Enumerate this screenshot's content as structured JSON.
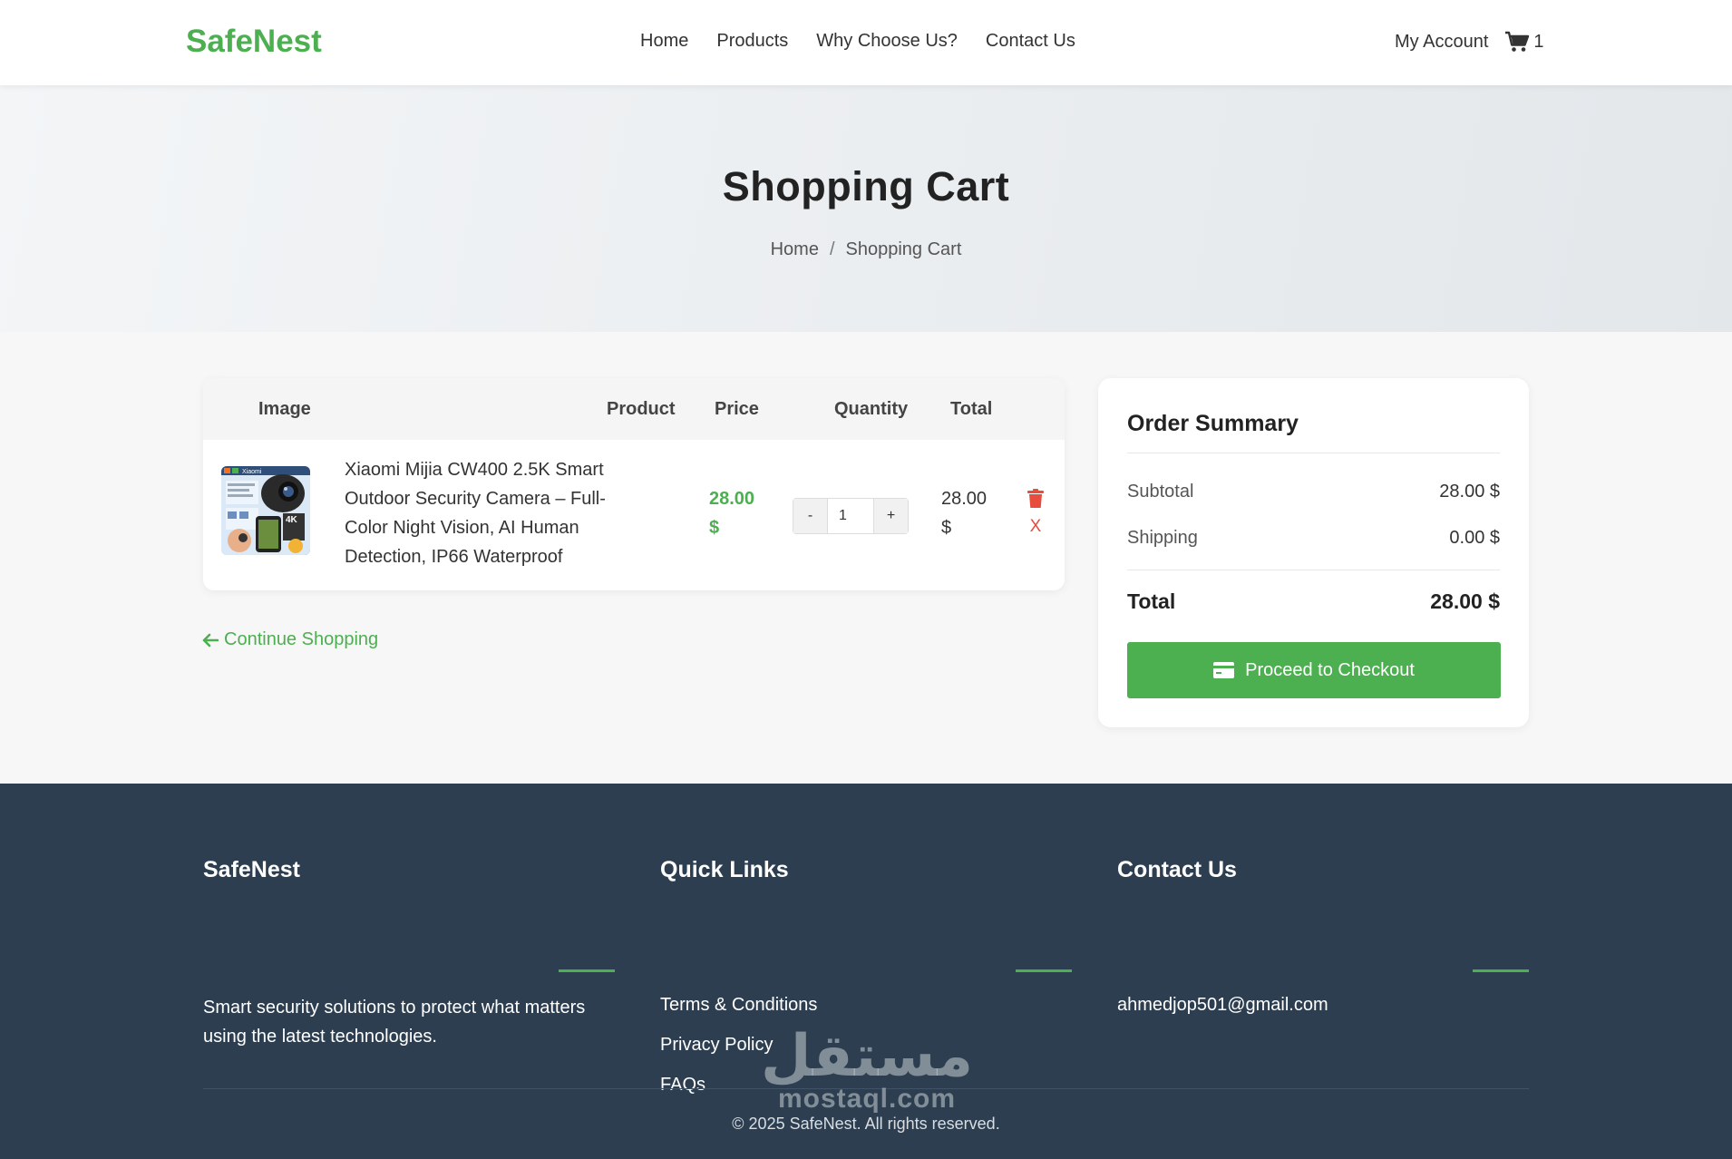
{
  "header": {
    "logo": "SafeNest",
    "nav": [
      "Home",
      "Products",
      "Why Choose Us?",
      "Contact Us"
    ],
    "account_label": "My Account",
    "cart_count": "1"
  },
  "hero": {
    "title": "Shopping Cart",
    "breadcrumb": [
      "Home",
      "Shopping Cart"
    ],
    "breadcrumb_separator": "/"
  },
  "cart": {
    "columns": [
      "Image",
      "Product",
      "Price",
      "Quantity",
      "Total"
    ],
    "items": [
      {
        "name": "Xiaomi Mijia CW400 2.5K Smart Outdoor Security Camera – Full-Color Night Vision, AI Human Detection, IP66 Waterproof",
        "price": "28.00 $",
        "quantity": "1",
        "total": "28.00 $",
        "remove_label": "X",
        "image_badge_text": "Xiaomi",
        "image_badge_4k": "4K"
      }
    ],
    "qty_minus": "-",
    "qty_plus": "+",
    "continue_label": "Continue Shopping"
  },
  "summary": {
    "title": "Order Summary",
    "subtotal_label": "Subtotal",
    "subtotal_value": "28.00 $",
    "shipping_label": "Shipping",
    "shipping_value": "0.00 $",
    "total_label": "Total",
    "total_value": "28.00 $",
    "checkout_label": "Proceed to Checkout"
  },
  "footer": {
    "brand_title": "SafeNest",
    "brand_text": "Smart security solutions to protect what matters using the latest technologies.",
    "links_title": "Quick Links",
    "links": [
      "Terms & Conditions",
      "Privacy Policy",
      "FAQs"
    ],
    "contact_title": "Contact Us",
    "contact_email": "ahmedjop501@gmail.com",
    "copyright": "© 2025 SafeNest. All rights reserved."
  },
  "watermark": {
    "arabic": "مستقل",
    "latin": "mostaql.com"
  },
  "colors": {
    "accent": "#4caf50",
    "danger": "#e74c3c",
    "footer_bg": "#2c3e50"
  },
  "icons": [
    "cart-icon",
    "trash-icon",
    "arrow-left-icon",
    "credit-card-icon"
  ]
}
